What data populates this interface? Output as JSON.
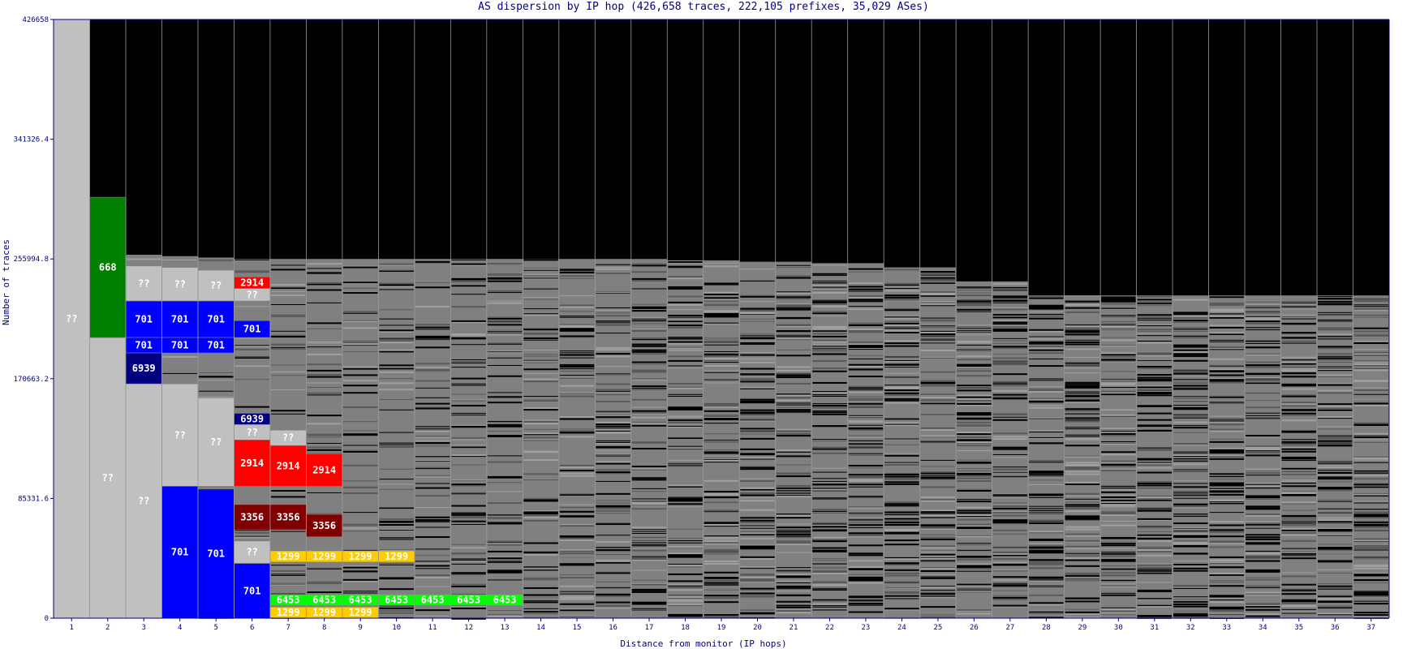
{
  "chart_data": {
    "type": "bar",
    "subtype": "stacked-dispersion",
    "title": "AS dispersion by IP hop (426,658 traces, 222,105 prefixes, 35,029 ASes)",
    "xlabel": "Distance from monitor (IP hops)",
    "ylabel": "Number of traces",
    "ylim": [
      0,
      426658
    ],
    "y_tick_labels": [
      "0",
      "85331.6",
      "170663.2",
      "255994.8",
      "341326.4",
      "426658"
    ],
    "y_ticks": [
      0,
      85331.6,
      170663.2,
      255994.8,
      341326.4,
      426658
    ],
    "categories": [
      "1",
      "2",
      "3",
      "4",
      "5",
      "6",
      "7",
      "8",
      "9",
      "10",
      "11",
      "12",
      "13",
      "14",
      "15",
      "16",
      "17",
      "18",
      "19",
      "20",
      "21",
      "22",
      "23",
      "24",
      "25",
      "26",
      "27",
      "28",
      "29",
      "30",
      "31",
      "32",
      "33",
      "34",
      "35",
      "36",
      "37"
    ],
    "colors": {
      "plot_background": "#000000",
      "axis": "#000080",
      "unknown": "#c0c0c0",
      "as668": "#008000",
      "as701": "#0000ff",
      "as6939": "#000080",
      "as2914": "#ff0000",
      "as3356": "#800000",
      "as1299": "#ffcc00",
      "as6453": "#00ff00",
      "other": "#808080"
    },
    "series": [
      {
        "name": "??",
        "color": "unknown",
        "segments": [
          {
            "hop": 1,
            "y0": 0,
            "y1": 426658,
            "label": "??"
          },
          {
            "hop": 2,
            "y0": 0,
            "y1": 200000,
            "label": "??"
          },
          {
            "hop": 3,
            "y0": 0,
            "y1": 167000,
            "label": "??"
          },
          {
            "hop": 3,
            "y0": 226000,
            "y1": 251000,
            "label": "??"
          },
          {
            "hop": 4,
            "y0": 94000,
            "y1": 167000,
            "label": "??"
          },
          {
            "hop": 4,
            "y0": 226000,
            "y1": 250000,
            "label": "??"
          },
          {
            "hop": 5,
            "y0": 94000,
            "y1": 157000,
            "label": "??"
          },
          {
            "hop": 5,
            "y0": 226000,
            "y1": 248000,
            "label": "??"
          },
          {
            "hop": 6,
            "y0": 39000,
            "y1": 55000,
            "label": "??"
          },
          {
            "hop": 6,
            "y0": 127000,
            "y1": 138000,
            "label": "??"
          },
          {
            "hop": 6,
            "y0": 226000,
            "y1": 235000,
            "label": "??"
          },
          {
            "hop": 7,
            "y0": 123000,
            "y1": 134000,
            "label": "??"
          }
        ]
      },
      {
        "name": "668",
        "color": "as668",
        "segments": [
          {
            "hop": 2,
            "y0": 200000,
            "y1": 300000,
            "label": "668"
          }
        ]
      },
      {
        "name": "701",
        "color": "as701",
        "segments": [
          {
            "hop": 3,
            "y0": 200000,
            "y1": 226000,
            "label": "701"
          },
          {
            "hop": 3,
            "y0": 189000,
            "y1": 200000,
            "label": "701"
          },
          {
            "hop": 4,
            "y0": 0,
            "y1": 94000,
            "label": "701"
          },
          {
            "hop": 4,
            "y0": 200000,
            "y1": 226000,
            "label": "701"
          },
          {
            "hop": 4,
            "y0": 189000,
            "y1": 200000,
            "label": "701"
          },
          {
            "hop": 5,
            "y0": 0,
            "y1": 92000,
            "label": "701"
          },
          {
            "hop": 5,
            "y0": 200000,
            "y1": 226000,
            "label": "701"
          },
          {
            "hop": 5,
            "y0": 189000,
            "y1": 200000,
            "label": "701"
          },
          {
            "hop": 6,
            "y0": 0,
            "y1": 39000,
            "label": "701"
          },
          {
            "hop": 6,
            "y0": 200000,
            "y1": 212000,
            "label": "701"
          }
        ]
      },
      {
        "name": "6939",
        "color": "as6939",
        "segments": [
          {
            "hop": 3,
            "y0": 167000,
            "y1": 189000,
            "label": "6939"
          },
          {
            "hop": 6,
            "y0": 138000,
            "y1": 146000,
            "label": "6939"
          }
        ]
      },
      {
        "name": "2914",
        "color": "as2914",
        "segments": [
          {
            "hop": 6,
            "y0": 94000,
            "y1": 127000,
            "label": "2914"
          },
          {
            "hop": 6,
            "y0": 235000,
            "y1": 243000,
            "label": "2914"
          },
          {
            "hop": 7,
            "y0": 94000,
            "y1": 123000,
            "label": "2914"
          },
          {
            "hop": 8,
            "y0": 94000,
            "y1": 117000,
            "label": "2914"
          }
        ]
      },
      {
        "name": "3356",
        "color": "as3356",
        "segments": [
          {
            "hop": 6,
            "y0": 63000,
            "y1": 81000,
            "label": "3356"
          },
          {
            "hop": 7,
            "y0": 63000,
            "y1": 81000,
            "label": "3356"
          },
          {
            "hop": 8,
            "y0": 58000,
            "y1": 74000,
            "label": "3356"
          }
        ]
      },
      {
        "name": "1299",
        "color": "as1299",
        "segments": [
          {
            "hop": 7,
            "y0": 40000,
            "y1": 48000,
            "label": "1299"
          },
          {
            "hop": 7,
            "y0": 0,
            "y1": 8000,
            "label": "1299"
          },
          {
            "hop": 8,
            "y0": 40000,
            "y1": 48000,
            "label": "1299"
          },
          {
            "hop": 8,
            "y0": 0,
            "y1": 8000,
            "label": "1299"
          },
          {
            "hop": 9,
            "y0": 40000,
            "y1": 48000,
            "label": "1299"
          },
          {
            "hop": 9,
            "y0": 0,
            "y1": 8000,
            "label": "1299"
          },
          {
            "hop": 10,
            "y0": 40000,
            "y1": 48000,
            "label": "1299"
          }
        ]
      },
      {
        "name": "6453",
        "color": "as6453",
        "segments": [
          {
            "hop": 7,
            "y0": 9000,
            "y1": 17000,
            "label": "6453"
          },
          {
            "hop": 8,
            "y0": 9000,
            "y1": 17000,
            "label": "6453"
          },
          {
            "hop": 9,
            "y0": 9000,
            "y1": 17000,
            "label": "6453"
          },
          {
            "hop": 10,
            "y0": 9000,
            "y1": 17000,
            "label": "6453"
          },
          {
            "hop": 11,
            "y0": 9000,
            "y1": 17000,
            "label": "6453"
          },
          {
            "hop": 12,
            "y0": 9000,
            "y1": 17000,
            "label": "6453"
          },
          {
            "hop": 13,
            "y0": 9000,
            "y1": 17000,
            "label": "6453"
          }
        ]
      },
      {
        "name": "other",
        "color": "other",
        "column_tops": [
          426658,
          300000,
          259000,
          258000,
          257000,
          256000,
          256000,
          256000,
          256000,
          256000,
          256000,
          256000,
          256000,
          256000,
          256000,
          256000,
          256000,
          255000,
          255000,
          254000,
          254000,
          253000,
          253000,
          250000,
          250000,
          240000,
          240000,
          230000,
          230000,
          230000,
          230000,
          230000,
          230000,
          230000,
          230000,
          230000,
          230000
        ]
      }
    ],
    "grid": false,
    "legend": "none"
  }
}
